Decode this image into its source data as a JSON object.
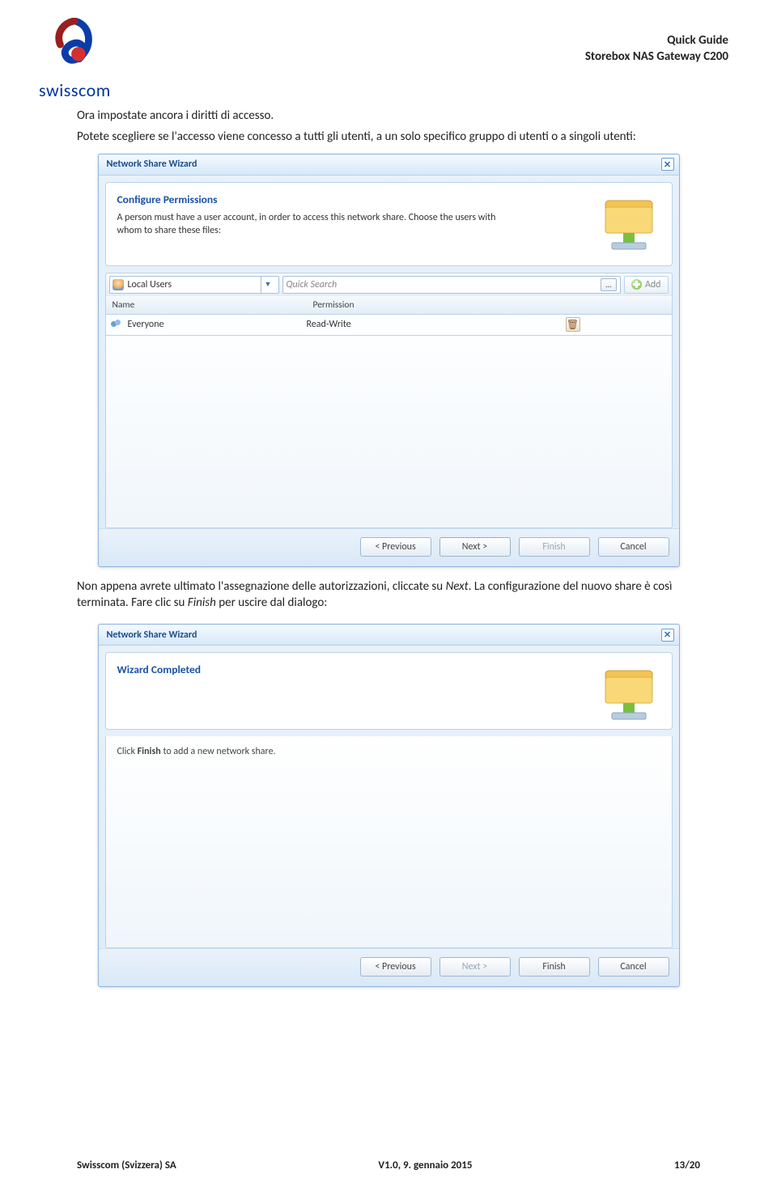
{
  "header": {
    "brand": "swisscom",
    "title_line1": "Quick Guide",
    "title_line2": "Storebox NAS Gateway C200"
  },
  "intro": {
    "p1": "Ora impostate ancora i diritti di accesso.",
    "p2": "Potete scegliere se l'accesso viene concesso a tutti gli utenti, a un solo specifico gruppo di utenti o a singoli utenti:"
  },
  "wizard1": {
    "title": "Network Share Wizard",
    "heading": "Configure Permissions",
    "desc": "A person must have a user account, in order to access this network share. Choose the users with whom to share these files:",
    "user_scope": "Local Users",
    "quick_search_placeholder": "Quick Search",
    "add_label": "Add",
    "columns": {
      "name": "Name",
      "permission": "Permission"
    },
    "row": {
      "name": "Everyone",
      "permission": "Read-Write"
    },
    "buttons": {
      "prev": "< Previous",
      "next": "Next >",
      "finish": "Finish",
      "cancel": "Cancel"
    }
  },
  "between": {
    "p1_a": "Non appena avrete ultimato l'assegnazione delle autorizzazioni, cliccate su ",
    "p1_next": "Next",
    "p1_b": ". La configurazione del nuovo share è così terminata.",
    "p2_a": " Fare clic su ",
    "p2_finish": "Finish",
    "p2_b": " per uscire dal dialogo:"
  },
  "wizard2": {
    "title": "Network Share Wizard",
    "heading": "Wizard Completed",
    "body_a": "Click ",
    "body_bold": "Finish",
    "body_b": " to add a new network share.",
    "buttons": {
      "prev": "< Previous",
      "next": "Next >",
      "finish": "Finish",
      "cancel": "Cancel"
    }
  },
  "footer": {
    "left": "Swisscom (Svizzera) SA",
    "center": "V1.0, 9. gennaio 2015",
    "right": "13/20"
  }
}
